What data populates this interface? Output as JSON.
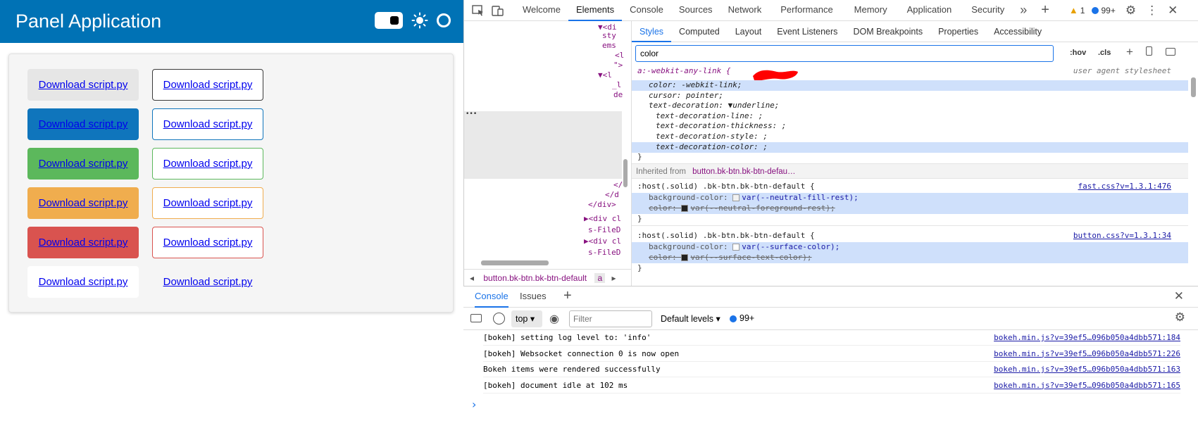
{
  "app": {
    "title": "Panel Application",
    "buttons": [
      {
        "label": "Download script.py",
        "bg": "#e6e6e6",
        "border": "#e6e6e6"
      },
      {
        "label": "Download script.py",
        "bg": "#ffffff",
        "border": "#3a3a3a"
      },
      {
        "label": "Download script.py",
        "bg": "#0f75bc",
        "border": "#0f75bc"
      },
      {
        "label": "Download script.py",
        "bg": "#ffffff",
        "border": "#0f75bc"
      },
      {
        "label": "Download script.py",
        "bg": "#5cb85c",
        "border": "#5cb85c"
      },
      {
        "label": "Download script.py",
        "bg": "#ffffff",
        "border": "#5cb85c"
      },
      {
        "label": "Download script.py",
        "bg": "#f0ad4e",
        "border": "#f0ad4e"
      },
      {
        "label": "Download script.py",
        "bg": "#ffffff",
        "border": "#f0ad4e"
      },
      {
        "label": "Download script.py",
        "bg": "#d9534f",
        "border": "#d9534f"
      },
      {
        "label": "Download script.py",
        "bg": "#ffffff",
        "border": "#d9534f"
      },
      {
        "label": "Download script.py",
        "bg": "#ffffff",
        "border": "#ffffff"
      },
      {
        "label": "Download script.py",
        "bg": "#f5f5f5",
        "border": "#f5f5f5"
      }
    ]
  },
  "devtools": {
    "tabs": [
      "Welcome",
      "Elements",
      "Console",
      "Sources",
      "Network",
      "Performance",
      "Memory",
      "Application",
      "Security"
    ],
    "warnings": "1",
    "messages": "99+",
    "elements_lines": [
      "▼<di",
      "sty",
      "ems",
      "<l",
      "\">",
      "▼<l",
      "_l",
      "de",
      "</",
      "</d",
      "</div>",
      "▶<div cl",
      "s-FileD",
      "▶<div cl",
      "s-FileD"
    ],
    "ellipsis": "•••",
    "breadcrumb": [
      "button.bk-btn.bk-btn-default",
      "a"
    ],
    "subtabs": [
      "Styles",
      "Computed",
      "Layout",
      "Event Listeners",
      "DOM Breakpoints",
      "Properties",
      "Accessibility"
    ],
    "filter_value": "color",
    "hov": ":hov",
    "cls": ".cls",
    "rule1": {
      "selector": "a:-webkit-any-link {",
      "origin": "user agent stylesheet",
      "lines": [
        {
          "text": "color: -webkit-link;",
          "hl": true
        },
        {
          "text": "cursor: pointer;",
          "hl": false
        },
        {
          "text": "text-decoration: ▼underline;",
          "hl": false
        },
        {
          "text": "text-decoration-line: ;",
          "hl": false,
          "indent": true
        },
        {
          "text": "text-decoration-thickness: ;",
          "hl": false,
          "indent": true
        },
        {
          "text": "text-decoration-style: ;",
          "hl": false,
          "indent": true
        },
        {
          "text": "text-decoration-color: ;",
          "hl": true,
          "indent": true
        }
      ],
      "close": "}"
    },
    "inherited_label": "Inherited from",
    "inherited_from": "button.bk-btn.bk-btn-defau…",
    "rule2": {
      "selector": ":host(.solid) .bk-btn.bk-btn-default {",
      "source": "fast.css?v=1.3.1:476",
      "line1": "background-color: ",
      "line1_val": "var(--neutral-fill-rest);",
      "line2": "color: ",
      "line2_val": "var(--neutral-foreground-rest);",
      "close": "}"
    },
    "rule3": {
      "selector": ":host(.solid) .bk-btn.bk-btn-default {",
      "source": "button.css?v=1.3.1:34",
      "line1": "background-color: ",
      "line1_val": "var(--surface-color);",
      "line2": "color: ",
      "line2_val": "var(--surface-text-color);",
      "close": "}"
    },
    "console": {
      "tabs": [
        "Console",
        "Issues"
      ],
      "context": "top",
      "filter_placeholder": "Filter",
      "levels": "Default levels",
      "count": "99+",
      "logs": [
        {
          "text": "[bokeh] setting log level to: 'info'",
          "src": "bokeh.min.js?v=39ef5…096b050a4dbb571:184"
        },
        {
          "text": "[bokeh] Websocket connection 0 is now open",
          "src": "bokeh.min.js?v=39ef5…096b050a4dbb571:226"
        },
        {
          "text": "Bokeh items were rendered successfully",
          "src": "bokeh.min.js?v=39ef5…096b050a4dbb571:163"
        },
        {
          "text": "[bokeh] document idle at 102 ms",
          "src": "bokeh.min.js?v=39ef5…096b050a4dbb571:165"
        }
      ],
      "prompt": "›"
    }
  }
}
